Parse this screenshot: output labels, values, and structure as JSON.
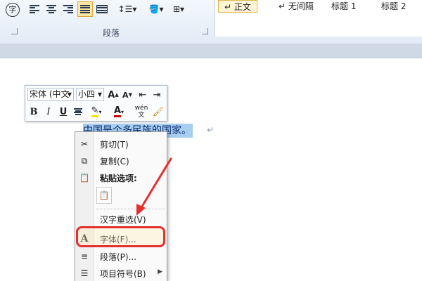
{
  "ribbon": {
    "paragraph_group_label": "段落",
    "font_group_icon": "字",
    "colors": {
      "active": "#fbe6a6",
      "accent": "#d9a93a"
    }
  },
  "styles": [
    {
      "label": "↵ 正文",
      "selected": true
    },
    {
      "label": "↵ 无间隔",
      "selected": false
    },
    {
      "label": "标题 1",
      "selected": false
    },
    {
      "label": "标题 2",
      "selected": false
    }
  ],
  "mini_toolbar": {
    "font_name": "宋体 (中文",
    "font_size": "小四",
    "grow_font": "A",
    "shrink_font": "A",
    "bold": "B",
    "italic": "I",
    "underline": "U",
    "font_color_letter": "A",
    "phonetic_guide": "wén\n文"
  },
  "document": {
    "selected_text": "中国是个多民族的国家。",
    "paragraph_mark": "↵"
  },
  "context_menu": {
    "cut": "剪切(T)",
    "copy": "复制(C)",
    "paste_options": "粘贴选项:",
    "reconvert": "汉字重选(V)",
    "font": "字体(F)...",
    "paragraph": "段落(P)...",
    "bullets": "项目符号(B)"
  },
  "annotation_color": "#e53030"
}
